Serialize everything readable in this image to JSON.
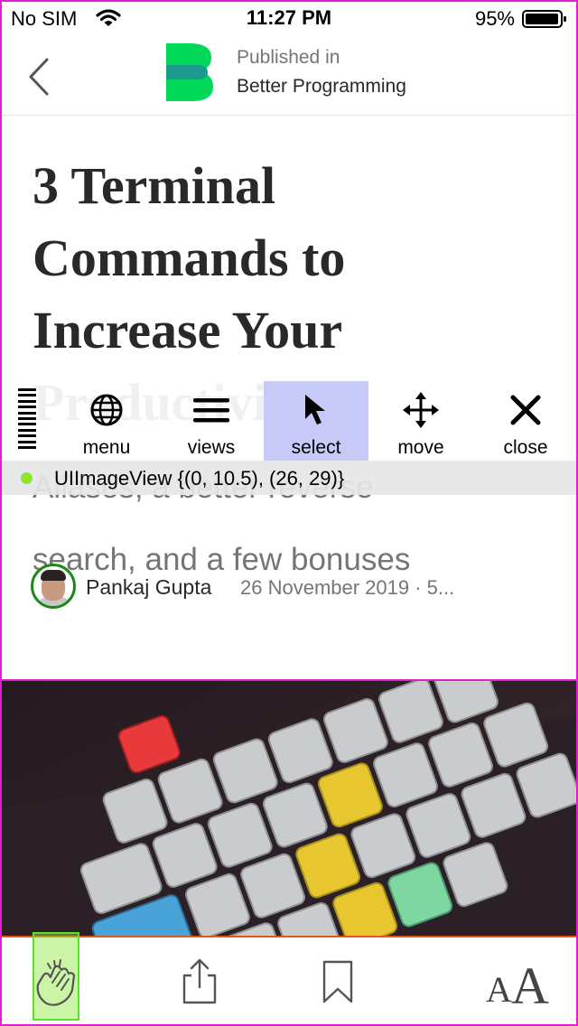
{
  "status_bar": {
    "carrier": "No SIM",
    "time": "11:27 PM",
    "battery_percent": "95%"
  },
  "header": {
    "publisher_kicker": "Published in",
    "publisher_name": "Better Programming",
    "logo_colors": [
      "#00d959",
      "#1c9a8e"
    ]
  },
  "article": {
    "title_lines": [
      "3 Terminal",
      "Commands to",
      "Increase Your",
      "Productivity"
    ],
    "subtitle_lines": [
      "Aliases, a better reverse",
      "search, and a few bonuses"
    ],
    "author": "Pankaj Gupta",
    "meta": "26 November 2019 · 5..."
  },
  "debug_toolbar": {
    "buttons": [
      {
        "id": "menu",
        "label": "menu",
        "icon": "globe-icon"
      },
      {
        "id": "views",
        "label": "views",
        "icon": "hamburger-icon"
      },
      {
        "id": "select",
        "label": "select",
        "icon": "cursor-arrow-icon",
        "active": true
      },
      {
        "id": "move",
        "label": "move",
        "icon": "move-arrows-icon"
      },
      {
        "id": "close",
        "label": "close",
        "icon": "close-x-icon"
      }
    ],
    "selection_text": "UIImageView {(0, 10.5), (26, 29)}",
    "selection_dot_color": "#8ee62a",
    "active_color": "#c7c9f7"
  },
  "tab_bar": {
    "icons": [
      "clap-icon",
      "share-icon",
      "bookmark-icon",
      "font-size-icon"
    ],
    "font_size_small": "A",
    "font_size_big": "A"
  }
}
